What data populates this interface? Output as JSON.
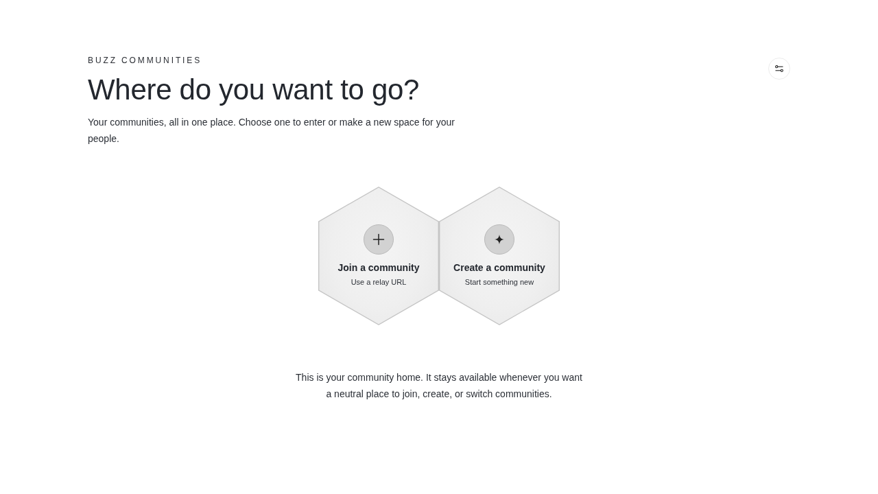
{
  "header": {
    "eyebrow": "BUZZ COMMUNITIES",
    "title": "Where do you want to go?",
    "description": "Your communities, all in one place. Choose one to enter or make a new space for your people."
  },
  "actions": [
    {
      "kind": "join",
      "title": "Join a community",
      "subtitle": "Use a relay URL"
    },
    {
      "kind": "create",
      "title": "Create a community",
      "subtitle": "Start something new"
    }
  ],
  "footer_note": "This is your community home. It stays available whenever you want a neutral place to join, create, or switch communities."
}
